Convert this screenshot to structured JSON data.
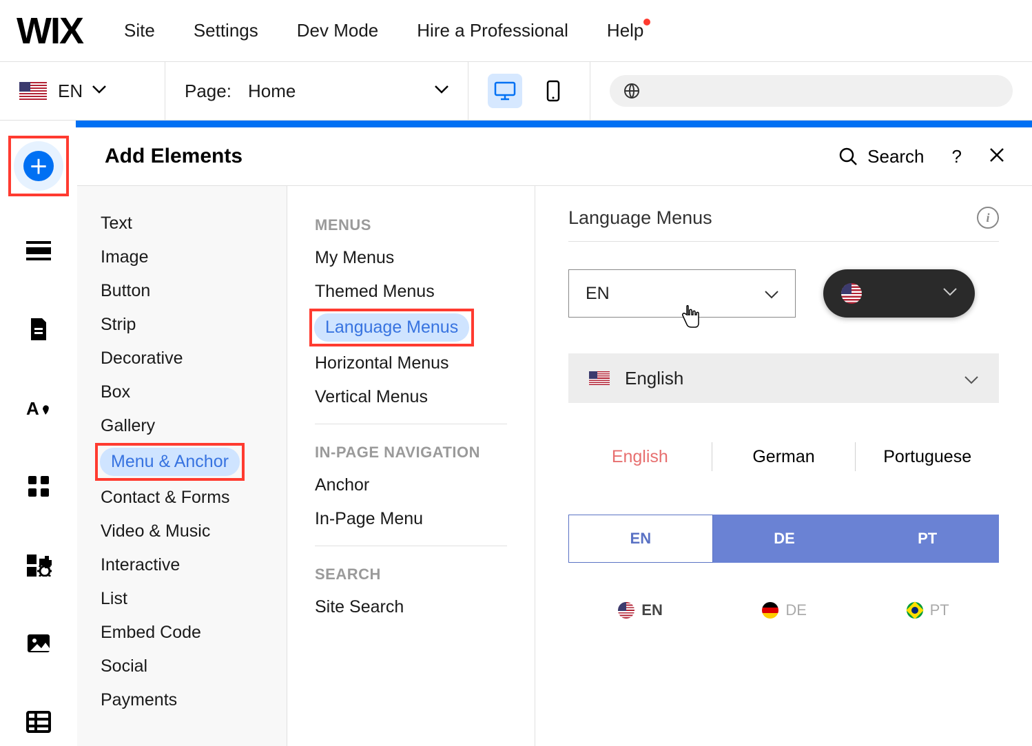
{
  "topnav": {
    "logo": "WIX",
    "items": [
      "Site",
      "Settings",
      "Dev Mode",
      "Hire a Professional",
      "Help"
    ]
  },
  "toolbar": {
    "lang_code": "EN",
    "page_label": "Page:",
    "page_name": "Home"
  },
  "panel": {
    "title": "Add Elements",
    "search_label": "Search",
    "help_symbol": "?"
  },
  "col1": {
    "items": [
      "Text",
      "Image",
      "Button",
      "Strip",
      "Decorative",
      "Box",
      "Gallery",
      "Menu & Anchor",
      "Contact & Forms",
      "Video & Music",
      "Interactive",
      "List",
      "Embed Code",
      "Social",
      "Payments"
    ],
    "highlight_index": 7
  },
  "col2": {
    "groups": [
      {
        "heading": "MENUS",
        "items": [
          "My Menus",
          "Themed Menus",
          "Language Menus",
          "Horizontal Menus",
          "Vertical Menus"
        ],
        "highlight_index": 2
      },
      {
        "heading": "IN-PAGE NAVIGATION",
        "items": [
          "Anchor",
          "In-Page Menu"
        ]
      },
      {
        "heading": "SEARCH",
        "items": [
          "Site Search"
        ]
      }
    ]
  },
  "col3": {
    "title": "Language Menus",
    "dropdown1_value": "EN",
    "expanded_value": "English",
    "tabs_text": [
      "English",
      "German",
      "Portuguese"
    ],
    "tabs_code": [
      "EN",
      "DE",
      "PT"
    ],
    "pills": [
      {
        "code": "EN",
        "flag": "us"
      },
      {
        "code": "DE",
        "flag": "de"
      },
      {
        "code": "PT",
        "flag": "br"
      }
    ]
  }
}
